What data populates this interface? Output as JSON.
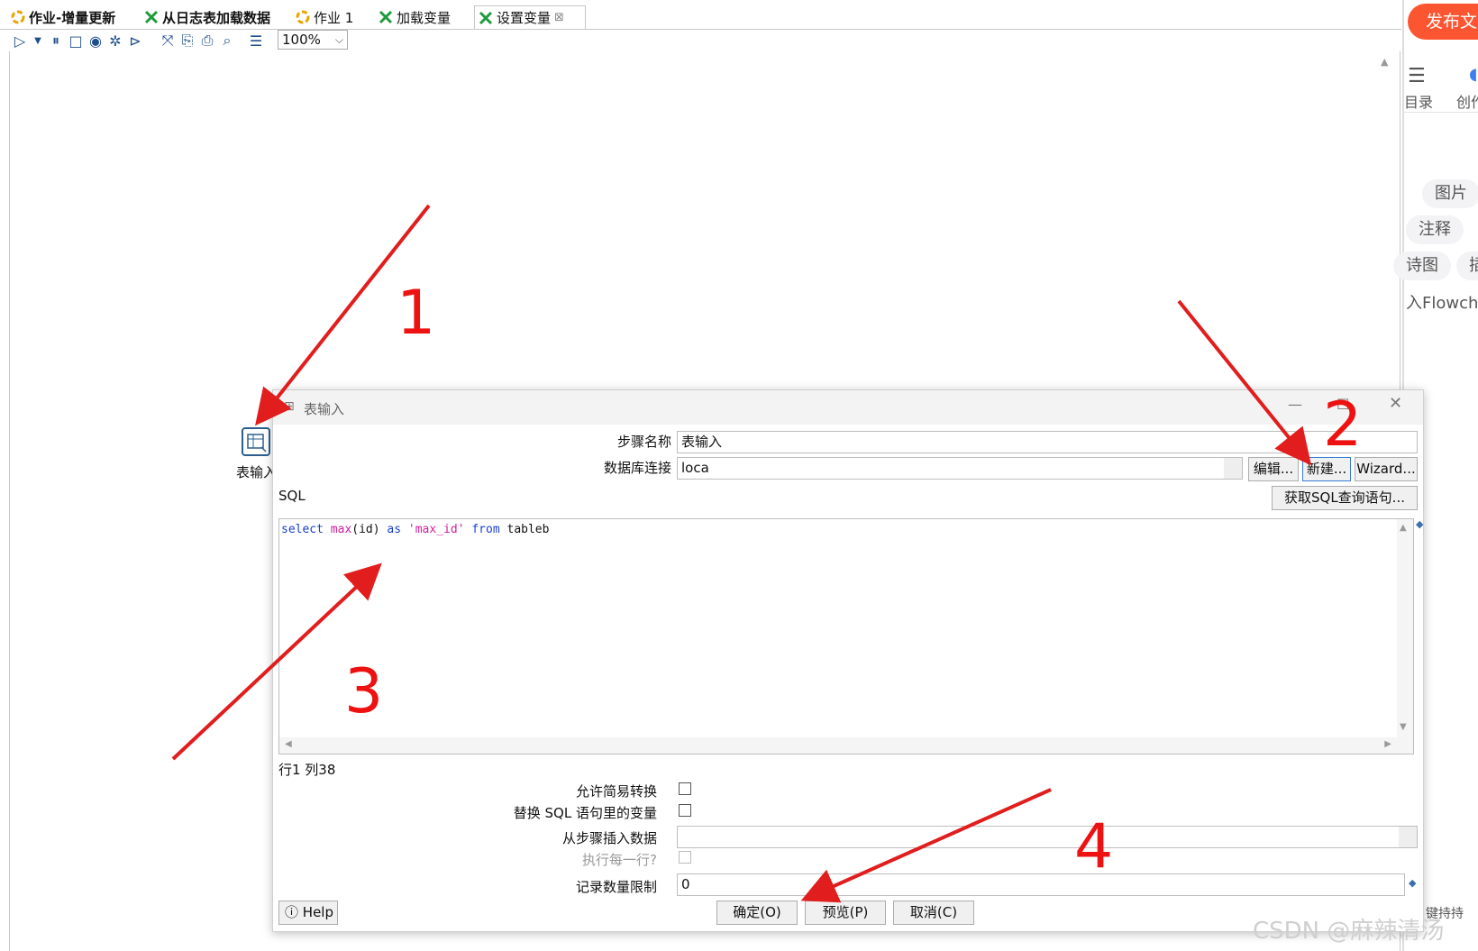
{
  "tabs": [
    {
      "label": "作业-增量更新",
      "icon": "job-icon",
      "bold": true
    },
    {
      "label": "从日志表加载数据",
      "icon": "transform-icon",
      "bold": true
    },
    {
      "label": "作业 1",
      "icon": "job-icon",
      "bold": false
    },
    {
      "label": "加载变量",
      "icon": "transform-icon",
      "bold": false
    },
    {
      "label": "设置变量",
      "icon": "transform-icon",
      "bold": false,
      "close": "⊠"
    }
  ],
  "toolbar": {
    "zoom": "100%"
  },
  "canvas": {
    "step_label": "表输入"
  },
  "right_panel": {
    "publish": "发布文",
    "dir_label": "目录",
    "create_label": "创作",
    "pills": [
      "图片",
      "注释",
      "诗图",
      "插",
      "入Flowcha"
    ],
    "bottom_text": "键持持"
  },
  "dialog": {
    "title": "表输入",
    "step_name_label": "步骤名称",
    "step_name_value": "表输入",
    "db_conn_label": "数据库连接",
    "db_conn_value": "loca",
    "edit_btn": "编辑...",
    "new_btn": "新建...",
    "wizard_btn": "Wizard...",
    "sql_label": "SQL",
    "get_sql_btn": "获取SQL查询语句...",
    "sql": {
      "k1": "select",
      "f1": "max",
      "p1": "(id)",
      "k2": "as",
      "s1": "'max_id'",
      "k3": "from",
      "t1": "tableb"
    },
    "cursor_pos": "行1 列38",
    "lazy_label": "允许简易转换",
    "replace_var_label": "替换 SQL 语句里的变量",
    "insert_from_label": "从步骤插入数据",
    "exec_each_label": "执行每一行?",
    "limit_label": "记录数量限制",
    "limit_value": "0",
    "help_btn": "Help",
    "ok_btn": "确定(O)",
    "preview_btn": "预览(P)",
    "cancel_btn": "取消(C)"
  },
  "annotations": [
    "1",
    "2",
    "3",
    "4"
  ],
  "watermark": "CSDN @麻辣清汤",
  "colors": {
    "arrow": "#e11d1d",
    "publish": "#fc5531",
    "keyword": "#1a3fcf",
    "function": "#d11e9b"
  }
}
